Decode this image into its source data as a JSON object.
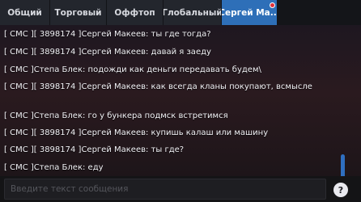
{
  "tabs": [
    {
      "label": "Общий"
    },
    {
      "label": "Торговый"
    },
    {
      "label": "Оффтоп"
    },
    {
      "label": "Глобальный"
    },
    {
      "label": "Сергей Ма..."
    }
  ],
  "messages": [
    "[ СМС ][ 3898174 ]Сергей Макеев: ты где тогда?",
    "[ СМС ][ 3898174 ]Сергей Макеев: давай я заеду",
    "[ СМС ]Степа Блек: подожди как деньги передавать будем\\",
    "[ СМС ][ 3898174 ]Сергей Макеев: как всегда кланы покупают, всмысле",
    "[ СМС ]Степа Блек: го у бункера подмск встретимся",
    "[ СМС ][ 3898174 ]Сергей Макеев: купишь калаш или машину",
    "[ СМС ][ 3898174 ]Сергей Макеев: ты где?",
    "[ СМС ]Степа Блек: еду"
  ],
  "input": {
    "placeholder": "Введите текст сообщения",
    "value": ""
  },
  "help_button": {
    "label": "?"
  },
  "colors": {
    "active_tab": "#2e6fb8",
    "scrollbar": "#2f6fc0",
    "badge": "#e0303a"
  }
}
